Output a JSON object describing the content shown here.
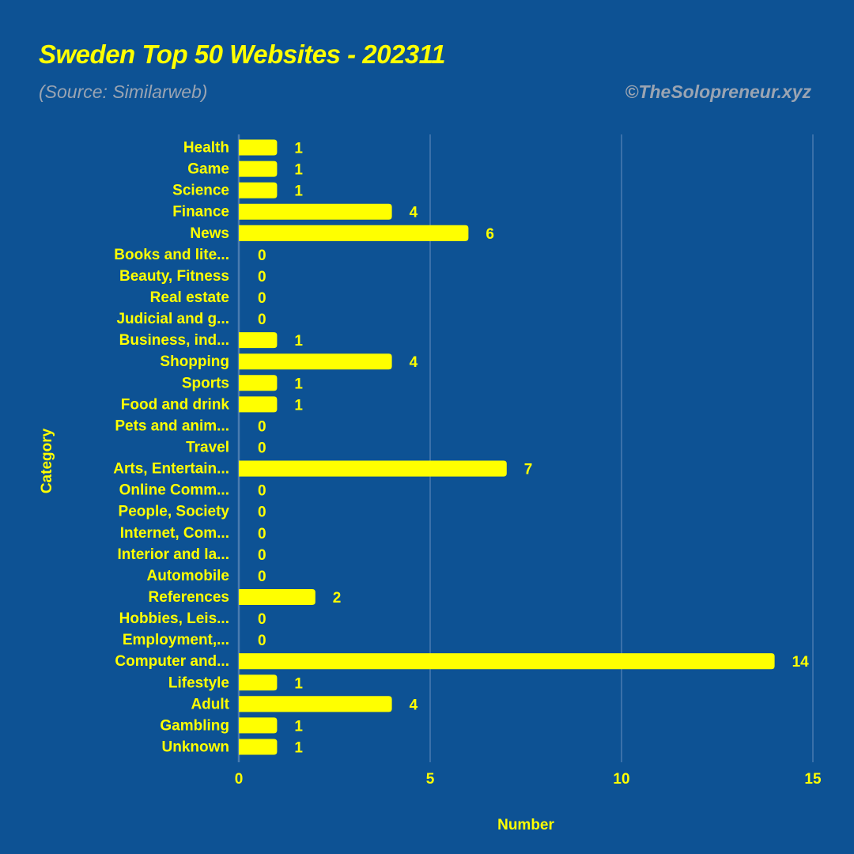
{
  "header": {
    "title": "Sweden Top 50 Websites - 202311",
    "subtitle": "(Source: Similarweb)",
    "credit": "©TheSolopreneur.xyz"
  },
  "colors": {
    "background": "#0d5294",
    "bar": "#ffff00",
    "text": "#ffff00",
    "muted_text": "#9aa4b2",
    "gridline": "#4a7bb0"
  },
  "chart_data": {
    "type": "bar",
    "orientation": "horizontal",
    "title": "Sweden Top 50 Websites - 202311",
    "subtitle": "(Source: Similarweb)",
    "xlabel": "Number",
    "ylabel": "Category",
    "xlim": [
      0,
      15
    ],
    "xticks": [
      0,
      5,
      10,
      15
    ],
    "grid": true,
    "categories": [
      "Health",
      "Game",
      "Science",
      "Finance",
      "News",
      "Books and lite...",
      "Beauty, Fitness",
      "Real estate",
      "Judicial and g...",
      "Business, ind...",
      "Shopping",
      "Sports",
      "Food and drink",
      "Pets and anim...",
      "Travel",
      "Arts, Entertain...",
      "Online Comm...",
      "People, Society",
      "Internet, Com...",
      "Interior and la...",
      "Automobile",
      "References",
      "Hobbies, Leis...",
      "Employment,...",
      "Computer and...",
      "Lifestyle",
      "Adult",
      "Gambling",
      "Unknown"
    ],
    "values": [
      1,
      1,
      1,
      4,
      6,
      0,
      0,
      0,
      0,
      1,
      4,
      1,
      1,
      0,
      0,
      7,
      0,
      0,
      0,
      0,
      0,
      2,
      0,
      0,
      14,
      1,
      4,
      1,
      1
    ]
  }
}
